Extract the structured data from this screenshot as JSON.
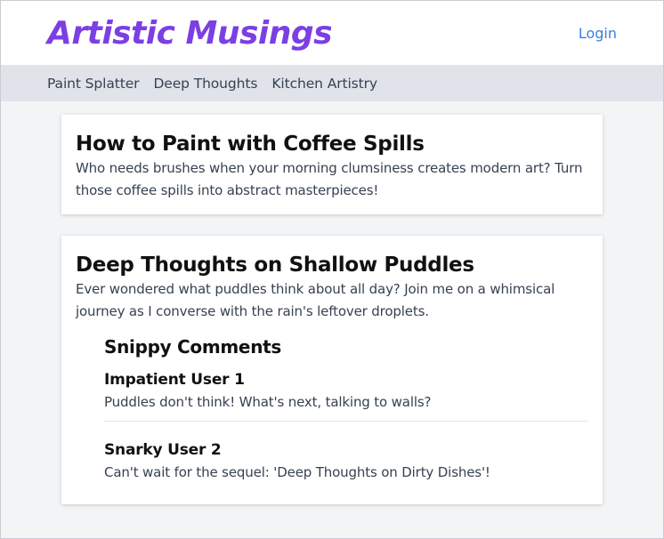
{
  "header": {
    "title": "Artistic Musings",
    "login_label": "Login"
  },
  "nav": {
    "items": [
      {
        "label": "Paint Splatter"
      },
      {
        "label": "Deep Thoughts"
      },
      {
        "label": "Kitchen Artistry"
      }
    ]
  },
  "posts": [
    {
      "title": "How to Paint with Coffee Spills",
      "body": "Who needs brushes when your morning clumsiness creates modern art? Turn those coffee spills into abstract masterpieces!"
    },
    {
      "title": "Deep Thoughts on Shallow Puddles",
      "body": "Ever wondered what puddles think about all day? Join me on a whimsical journey as I converse with the rain's leftover droplets.",
      "comments": {
        "heading": "Snippy Comments",
        "items": [
          {
            "author": "Impatient User 1",
            "text": "Puddles don't think! What's next, talking to walls?"
          },
          {
            "author": "Snarky User 2",
            "text": "Can't wait for the sequel: 'Deep Thoughts on Dirty Dishes'!"
          }
        ]
      }
    }
  ],
  "colors": {
    "brand": "#7b3fe4",
    "link": "#3b7fd9",
    "nav_background": "#e0e4ea",
    "page_background": "#f3f4f6"
  }
}
